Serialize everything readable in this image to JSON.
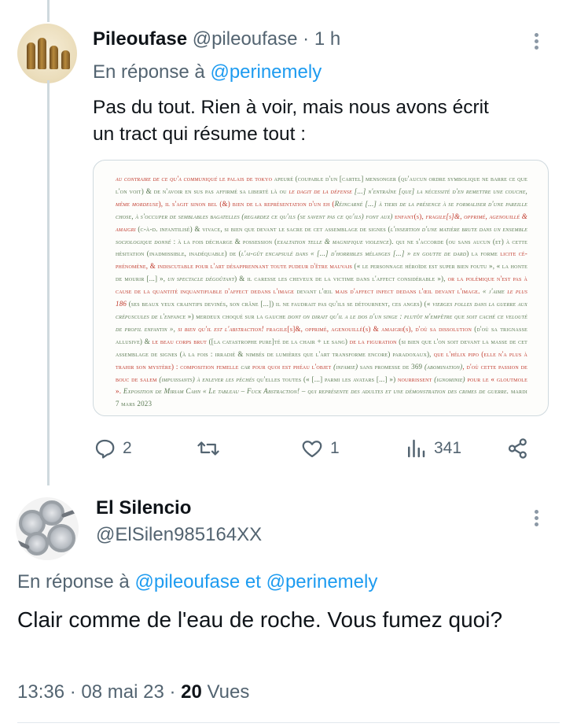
{
  "tweet1": {
    "display_name": "Pileoufase",
    "handle": "@pileoufase",
    "separator": "·",
    "time": "1 h",
    "reply_prefix": "En réponse à",
    "reply_mention": "@perinemely",
    "text_line1": "Pas du tout. Rien à voir, mais nous avons écrit",
    "text_line2": "un tract qui résume tout :",
    "actions": {
      "reply_count": "2",
      "retweet_count": "",
      "like_count": "1",
      "view_count": "341"
    },
    "tract_paragraphs": [
      {
        "t": "au contraire de ce qu'a communiqué",
        "c": "r i"
      },
      {
        "t": " le palais de tokyo ",
        "c": "r"
      },
      {
        "t": "apeuré (coupable d'un [cartel] mensonger (qu'aucun ordre symbolique ne barre ce que l'on voit) & de n'avoir en sus pas affirmé sa liberté là ou ",
        "c": ""
      },
      {
        "t": "le dagit de la défense",
        "c": "r i"
      },
      {
        "t": " [...] n'entraîne [que] la nécessité d'en remettre une couche, ",
        "c": "i"
      },
      {
        "t": "même mordeuse",
        "c": "r i"
      },
      {
        "t": "), il s'agit sinon bel (&) bien de la représentation d'un eh (",
        "c": "r"
      },
      {
        "t": "Réincarné [...] à tiers de la présence à se formaliser d'une pareille chose, à s'occuper de semblables bagatelles ",
        "c": "i"
      },
      {
        "t": "(regardez ce qu'ils (se savent pas ce qu'ils) font aux) ",
        "c": "i"
      },
      {
        "t": "enfant(s), ",
        "c": "r"
      },
      {
        "t": "fragile[s]&, opprimé, agenouillé & amaigri ",
        "c": "r i"
      },
      {
        "t": "(c-à-d. infantilisé) & vivace, si bien que devant le sacre de cet assemblage de signes (",
        "c": ""
      },
      {
        "t": "l'insertion d'une matière brute dans un ensemble sociologique donné",
        "c": "i"
      },
      {
        "t": " : à la fois décharge & possession (",
        "c": ""
      },
      {
        "t": "exaltation telle & magnifique violence",
        "c": "i"
      },
      {
        "t": "). qui ne s'accorde (ou sans aucun (et) à cette hésitation (inadmissible, inadéquable) de (",
        "c": ""
      },
      {
        "t": "l'ai-gût encapsulé dans « [...] d'horribles mélanges [...] » en goutte de dard",
        "c": "i"
      },
      {
        "t": ") la forme ",
        "c": ""
      },
      {
        "t": "licite cé-phénomène, & indiscutable pour l'art désapprennant toute pudeur d'être mauvais",
        "c": "r"
      },
      {
        "t": " (« le personnage héroïde est super bien foutu », « la honte de mourir [...] », ",
        "c": ""
      },
      {
        "t": "un spectacle dégoûtant",
        "c": "i"
      },
      {
        "t": ") & il caresse les cheveux de la victime dans l'affect considérable »), ",
        "c": ""
      },
      {
        "t": "or la polémique n'est pas à cause de la quantité inquantifiable d'affect dedans l'image",
        "c": "r"
      },
      {
        "t": " devant l'œil ",
        "c": ""
      },
      {
        "t": "mais d'affect infect dedans l'œil devant l'image.",
        "c": "r"
      },
      {
        "t": " « j'aime ",
        "c": "i"
      },
      {
        "t": "le plus 186",
        "c": "r i"
      },
      {
        "t": " (ses beaux yeux craintifs devinés, son crâne [...]) il ne faudrait pas qu'ils se détournent, ces anges) (« ",
        "c": ""
      },
      {
        "t": "vierges folles dans la guerre aux crépuscules de l'enfance",
        "c": "i"
      },
      {
        "t": " ») merdeux choqué sur la gauche ",
        "c": ""
      },
      {
        "t": "dont on dirait qu'il a le dos d'un singe",
        "c": "i"
      },
      {
        "t": " : plutôt m'empêtre que soit caché ce velouté de profil enfantin », ",
        "c": "i"
      },
      {
        "t": "si bien qu'il est l'abstraction! ",
        "c": "r i"
      },
      {
        "t": "fragile[s]&, opprimé, agenouillé(s) & amaigri(s), d'où sa dissolution ",
        "c": "r"
      },
      {
        "t": "(d'où sa trignasse allusive) & ",
        "c": ""
      },
      {
        "t": "le beau corps brut",
        "c": "r"
      },
      {
        "t": " ([la catastrophe pure]té de la chair + le sang) ",
        "c": ""
      },
      {
        "t": "de la figuration ",
        "c": "r"
      },
      {
        "t": "(si bien que l'on soit devant la masse de cet assemblage de signes (à la fois : irradié & nimbés de lumières que l'art transforme encore) paradoxaux), ",
        "c": ""
      },
      {
        "t": "que l'hélix pipo (elle n'a plus à trahir son mystère) : composition femelle ",
        "c": "r"
      },
      {
        "t": "car",
        "c": "i"
      },
      {
        "t": " pour quoi est phéau l'objet ",
        "c": "r"
      },
      {
        "t": "(infamie)",
        "c": "i"
      },
      {
        "t": " sans promesse de 369 ",
        "c": ""
      },
      {
        "t": "(abomination)",
        "c": "i"
      },
      {
        "t": ", d'où cette passion de bouc de salem ",
        "c": "r"
      },
      {
        "t": "(impuissants) à enlever les péchés",
        "c": "i"
      },
      {
        "t": " qu'elles toutes (« [...] parmi les avatars [...] ») ",
        "c": ""
      },
      {
        "t": "nourrissent ",
        "c": "r"
      },
      {
        "t": "(ignominie)",
        "c": "i"
      },
      {
        "t": " pour le « gloutmole ». ",
        "c": "r"
      },
      {
        "t": "Exposition de Miriam Cahn « Le tableau – Fuck Abstraction! – qui représente des adultes et une démonstration des crimes de guerre. ",
        "c": "i"
      },
      {
        "t": "mardi 7 mars 2023",
        "c": ""
      }
    ]
  },
  "tweet2": {
    "display_name": "El Silencio",
    "handle": "@ElSilen985164XX",
    "reply_prefix": "En réponse à",
    "reply_mention1": "@pileoufase",
    "reply_and": "et",
    "reply_mention2": "@perinemely",
    "text": "Clair comme de l'eau de roche. Vous fumez quoi?",
    "time": "13:36",
    "separator": "·",
    "date": "08 mai 23",
    "view_count": "20",
    "view_label": "Vues"
  },
  "icons": [
    "more-icon",
    "reply-icon",
    "retweet-icon",
    "like-icon",
    "views-icon",
    "share-icon"
  ],
  "colors": {
    "accent": "#1d9bf0",
    "muted": "#536471",
    "text": "#0f1419",
    "border": "#cfd9de",
    "tract_red": "#c0392b",
    "tract_green": "#5a7a52"
  }
}
